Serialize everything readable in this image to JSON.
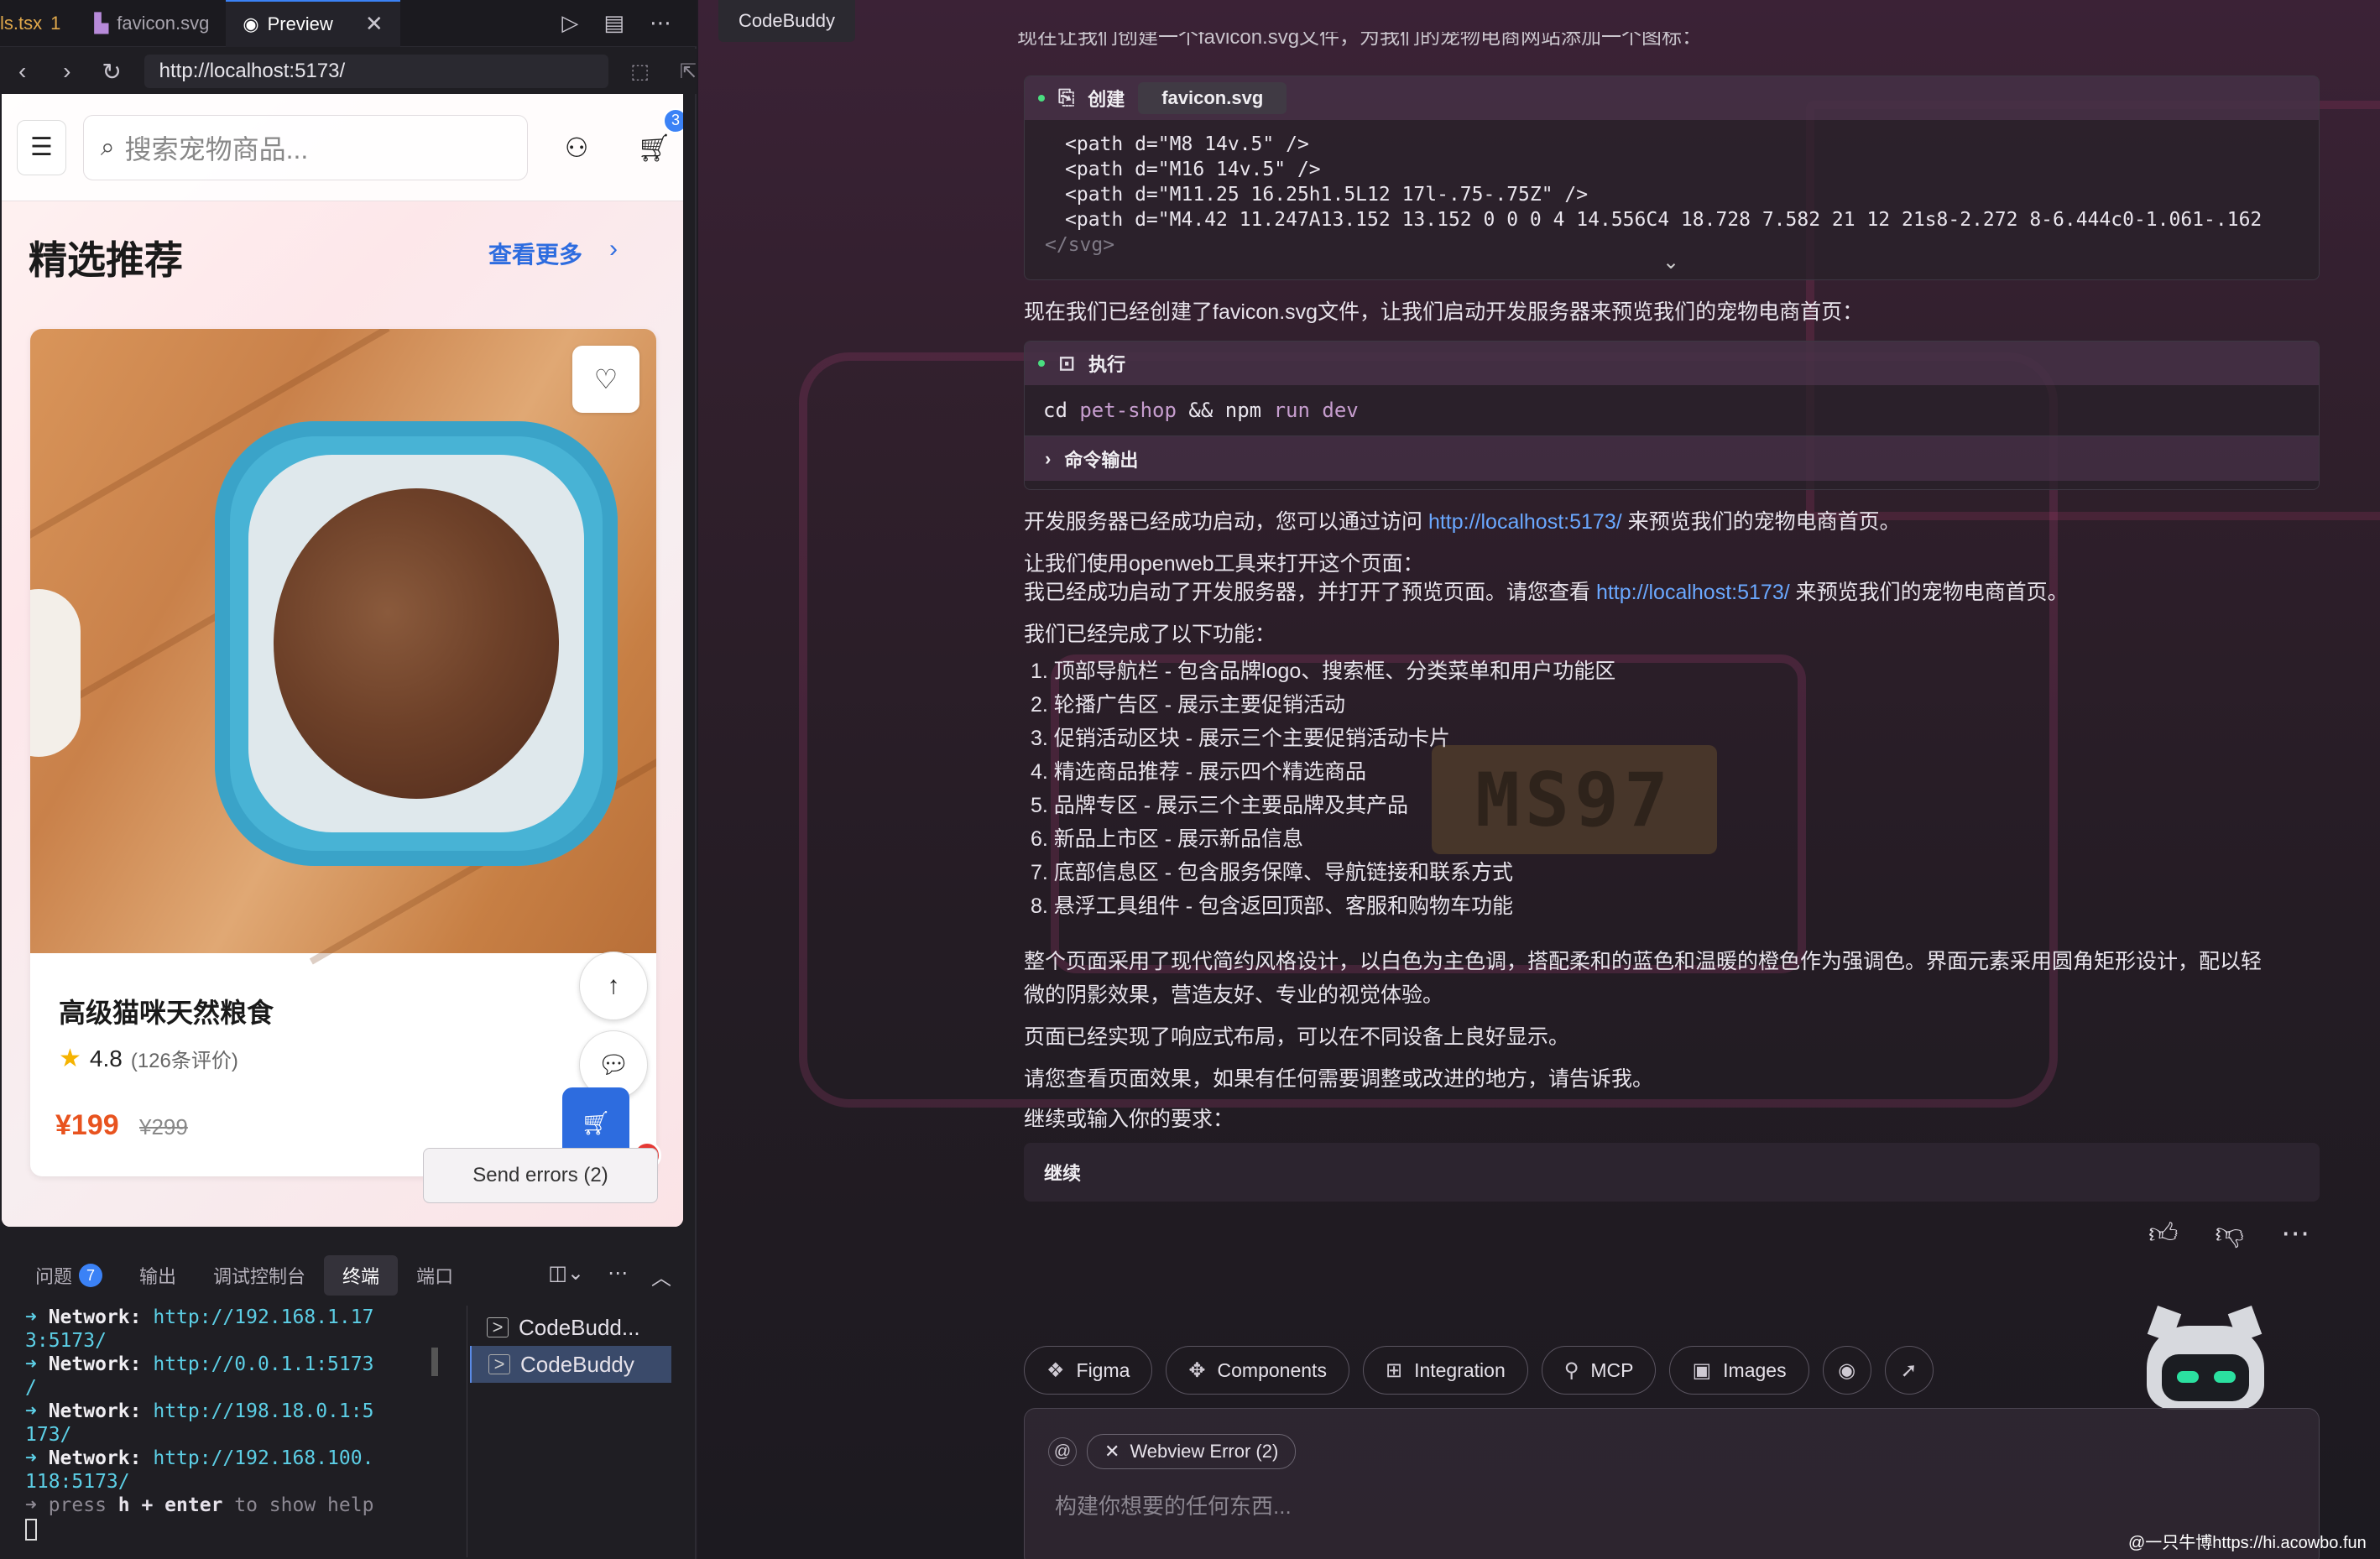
{
  "editor": {
    "tabs": [
      {
        "label": "ls.tsx",
        "count": "1"
      },
      {
        "label": "favicon.svg"
      },
      {
        "label": "Preview"
      }
    ]
  },
  "browser": {
    "url": "http://localhost:5173/"
  },
  "site": {
    "search_placeholder": "搜索宠物商品...",
    "cart_count": "3",
    "section_title": "精选推荐",
    "see_more": "查看更多",
    "product": {
      "name": "高级猫咪天然粮食",
      "rating": "4.8",
      "reviews": "(126条评价)",
      "price": "¥199",
      "old_price": "¥299"
    },
    "send_errors": "Send errors (2)"
  },
  "panel": {
    "tabs": [
      {
        "label": "问题",
        "badge": "7"
      },
      {
        "label": "输出"
      },
      {
        "label": "调试控制台"
      },
      {
        "label": "终端"
      },
      {
        "label": "端口"
      }
    ],
    "terminal_lines": [
      {
        "label": "Network:",
        "url": "http://192.168.1.17",
        "cont": "3:5173/"
      },
      {
        "label": "Network:",
        "url": "http://0.0.1.1:5173",
        "cont": "/"
      },
      {
        "label": "Network:",
        "url": "http://198.18.0.1:5",
        "cont": "173/"
      },
      {
        "label": "Network:",
        "url": "http://192.168.100.",
        "cont": "118:5173/"
      }
    ],
    "help_line": {
      "a": "press ",
      "h": "h + enter",
      "b": " to show help"
    },
    "terminals": [
      "CodeBudd...",
      "CodeBuddy"
    ]
  },
  "chat": {
    "tab_title": "CodeBuddy",
    "intro_cut": "现在让我们创建一个favicon.svg文件，为我们的宠物电商网站添加一个图标：",
    "create_block": {
      "action": "创建",
      "file": "favicon.svg",
      "lines": [
        "<path d=\"M8 14v.5\" />",
        "<path d=\"M16 14v.5\" />",
        "<path d=\"M11.25 16.25h1.5L12 17l-.75-.75Z\" />",
        "<path d=\"M4.42 11.247A13.152 13.152 0 0 0 4 14.556C4 18.728 7.582 21 12 21s8-2.272 8-6.444c0-1.061-.162"
      ],
      "close_tag": "</svg>"
    },
    "msg_run": "现在我们已经创建了favicon.svg文件，让我们启动开发服务器来预览我们的宠物电商首页：",
    "exec_block": {
      "action": "执行",
      "cmd_a": "cd",
      "cmd_b": "pet-shop",
      "cmd_c": "&&",
      "cmd_d": "npm",
      "cmd_e": "run dev",
      "output_label": "命令输出"
    },
    "msg_started_a": "开发服务器已经成功启动，您可以通过访问 ",
    "msg_link": "http://localhost:5173/",
    "msg_started_b": " 来预览我们的宠物电商首页。",
    "msg_openweb": "让我们使用openweb工具来打开这个页面：",
    "msg_opened_a": "我已经成功启动了开发服务器，并打开了预览页面。请您查看 ",
    "msg_opened_b": " 来预览我们的宠物电商首页。",
    "msg_done": "我们已经完成了以下功能：",
    "features": [
      "1. 顶部导航栏 - 包含品牌logo、搜索框、分类菜单和用户功能区",
      "2. 轮播广告区 - 展示主要促销活动",
      "3. 促销活动区块 - 展示三个主要促销活动卡片",
      "4. 精选商品推荐 - 展示四个精选商品",
      "5. 品牌专区 - 展示三个主要品牌及其产品",
      "6. 新品上市区 - 展示新品信息",
      "7. 底部信息区 - 包含服务保障、导航链接和联系方式",
      "8. 悬浮工具组件 - 包含返回顶部、客服和购物车功能"
    ],
    "msg_design_1": "整个页面采用了现代简约风格设计，以白色为主色调，搭配柔和的蓝色和温暖的橙色作为强调色。界面元素采用圆角矩形设计，配以轻",
    "msg_design_2": "微的阴影效果，营造友好、专业的视觉体验。",
    "msg_responsive": "页面已经实现了响应式布局，可以在不同设备上良好显示。",
    "msg_check": "请您查看页面效果，如果有任何需要调整或改进的地方，请告诉我。",
    "msg_continue": "继续或输入你的要求：",
    "reply": "继续",
    "chips": [
      "Figma",
      "Components",
      "Integration",
      "MCP",
      "Images"
    ],
    "error_tag": "Webview Error (2)",
    "input_placeholder": "构建你想要的任何东西...",
    "background_plate": "MS97"
  },
  "watermark": "@一只牛博https://hi.acowbo.fun"
}
